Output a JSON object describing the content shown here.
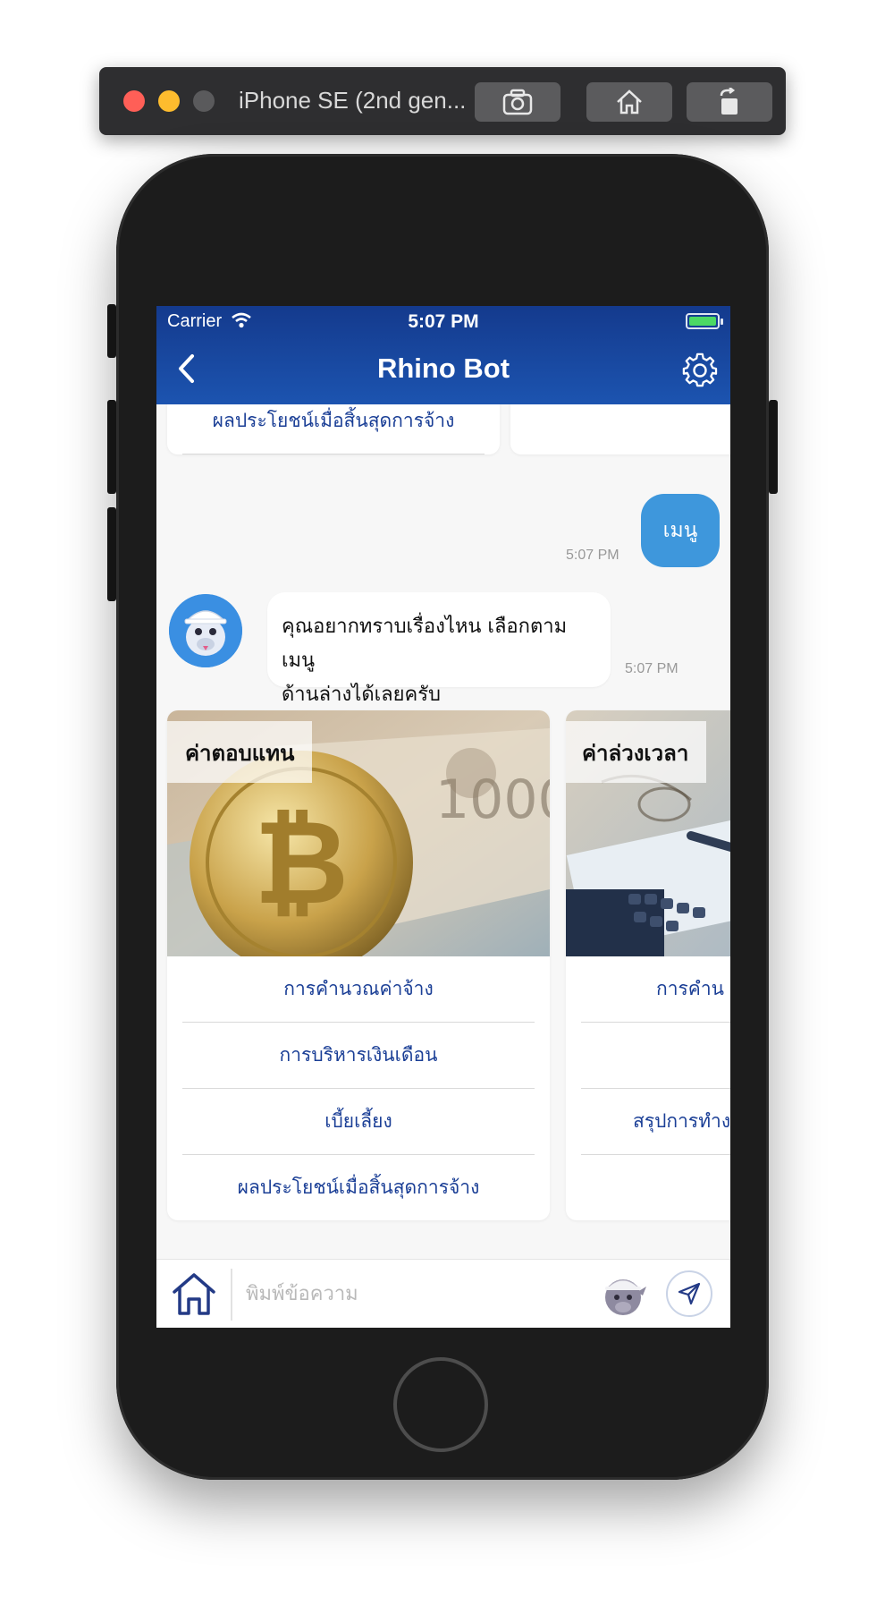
{
  "simulator": {
    "title": "iPhone SE (2nd gen...",
    "buttons": [
      "screenshot-icon",
      "home-icon",
      "rotate-icon"
    ]
  },
  "status_bar": {
    "carrier": "Carrier",
    "time": "5:07 PM"
  },
  "nav": {
    "title": "Rhino Bot",
    "back_icon": "chevron-left-icon",
    "settings_icon": "gear-icon"
  },
  "chat": {
    "previous_card": {
      "last_item": "ผลประโยชน์เมื่อสิ้นสุดการจ้าง"
    },
    "user_message": {
      "text": "เมนู",
      "time": "5:07 PM"
    },
    "bot_message": {
      "line1": "คุณอยากทราบเรื่องไหน เลือกตามเมนู",
      "line2": "ด้านล่างได้เลยครับ",
      "time": "5:07 PM"
    },
    "cards": [
      {
        "title": "ค่าตอบแทน",
        "items": [
          "การคำนวณค่าจ้าง",
          "การบริหารเงินเดือน",
          "เบี้ยเลี้ยง",
          "ผลประโยชน์เมื่อสิ้นสุดการจ้าง"
        ]
      },
      {
        "title": "ค่าล่วงเวลา",
        "items": [
          "การคำน",
          "",
          "สรุปการทำง",
          ""
        ]
      }
    ]
  },
  "input_bar": {
    "placeholder": "พิมพ์ข้อความ"
  },
  "colors": {
    "header_top": "#143a8d",
    "header_bottom": "#1c54b0",
    "user_bubble": "#3e97dc",
    "menu_text": "#1b3f96"
  }
}
